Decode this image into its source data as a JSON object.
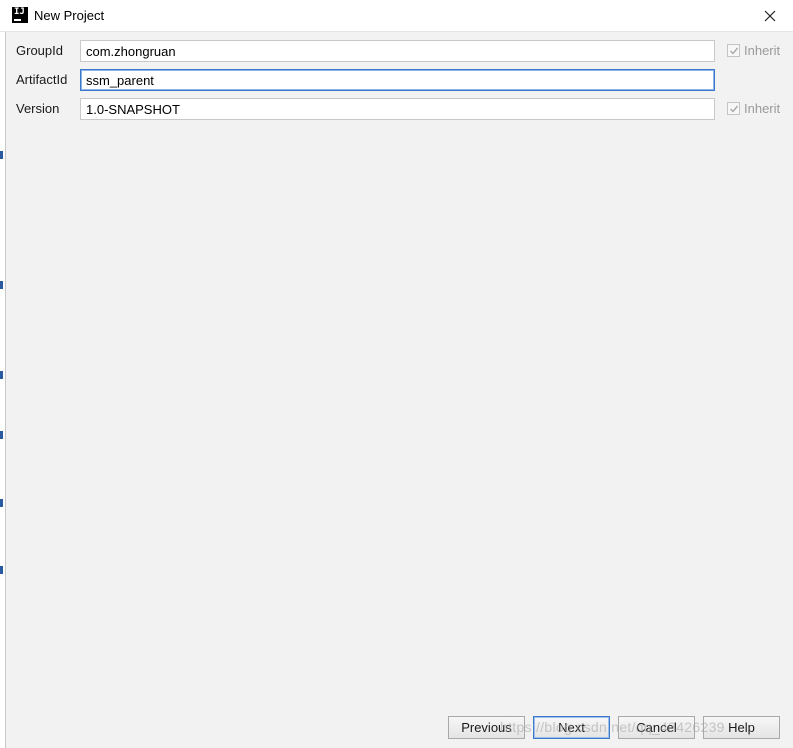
{
  "window": {
    "title": "New Project",
    "icon": "intellij-icon",
    "icon_text": "IJ"
  },
  "form": {
    "group_id": {
      "label": "GroupId",
      "value": "com.zhongruan",
      "inherit_label": "Inherit",
      "inherit_checked": true
    },
    "artifact_id": {
      "label": "ArtifactId",
      "value": "ssm_parent"
    },
    "version": {
      "label": "Version",
      "value": "1.0-SNAPSHOT",
      "inherit_label": "Inherit",
      "inherit_checked": true
    }
  },
  "buttons": {
    "previous": "Previous",
    "next": "Next",
    "cancel": "Cancel",
    "help": "Help"
  },
  "watermark": "https://blog.csdn.net/qq_43426239",
  "colors": {
    "dialog_bg": "#f2f2f2",
    "focus_border": "#3b78c9",
    "disabled_text": "#9a9a9a"
  }
}
